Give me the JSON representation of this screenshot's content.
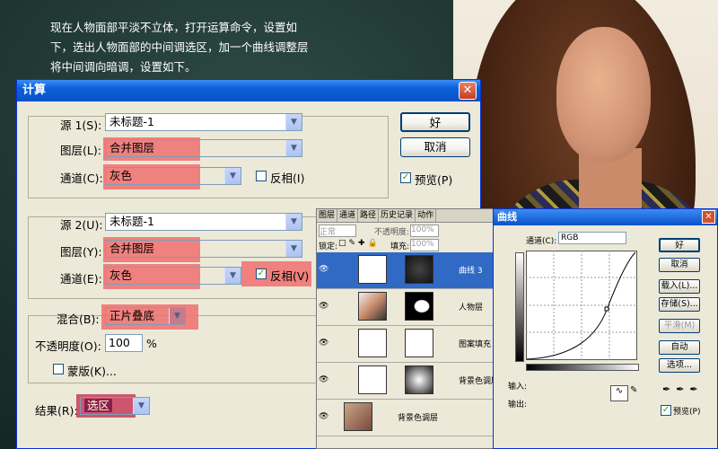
{
  "tutorial_text": [
    "现在人物面部平淡不立体，打开运算命令，设置如",
    "下，选出人物面部的中间调选区，加一个曲线调整层",
    "将中间调向暗调，设置如下。"
  ],
  "calc": {
    "title": "计算",
    "close": "✕",
    "src1": {
      "label": "源 1(S):",
      "file": "未标题-1",
      "layer_label": "图层(L):",
      "layer": "合并图层",
      "channel_label": "通道(C):",
      "channel": "灰色",
      "invert": "反相(I)"
    },
    "src2": {
      "label": "源 2(U):",
      "file": "未标题-1",
      "layer_label": "图层(Y):",
      "layer": "合并图层",
      "channel_label": "通道(E):",
      "channel": "灰色",
      "invert": "反相(V)"
    },
    "blend_label": "混合(B):",
    "blend": "正片叠底",
    "opacity_label": "不透明度(O):",
    "opacity": "100",
    "percent": "%",
    "mask": "蒙版(K)...",
    "result_label": "结果(R):",
    "result": "选区",
    "ok": "好",
    "cancel": "取消",
    "preview": "预览(P)"
  },
  "layers": {
    "tabs": [
      "图层",
      "通道",
      "路径",
      "历史记录",
      "动作"
    ],
    "mode": "正常",
    "opacity_label": "不透明度:",
    "opacity": "100%",
    "lock_label": "锁定:",
    "fill_label": "填充:",
    "fill": "100%",
    "rows": [
      "曲线 3",
      "人物层",
      "图案填充 1",
      "背景色调层",
      "背景色调层"
    ]
  },
  "curves": {
    "title": "曲线",
    "channel_label": "通道(C):",
    "channel": "RGB",
    "buttons": [
      "好",
      "取消",
      "载入(L)...",
      "存储(S)...",
      "平滑(M)",
      "自动",
      "选项..."
    ],
    "input_label": "输入:",
    "output_label": "输出:",
    "preview": "预览(P)"
  }
}
